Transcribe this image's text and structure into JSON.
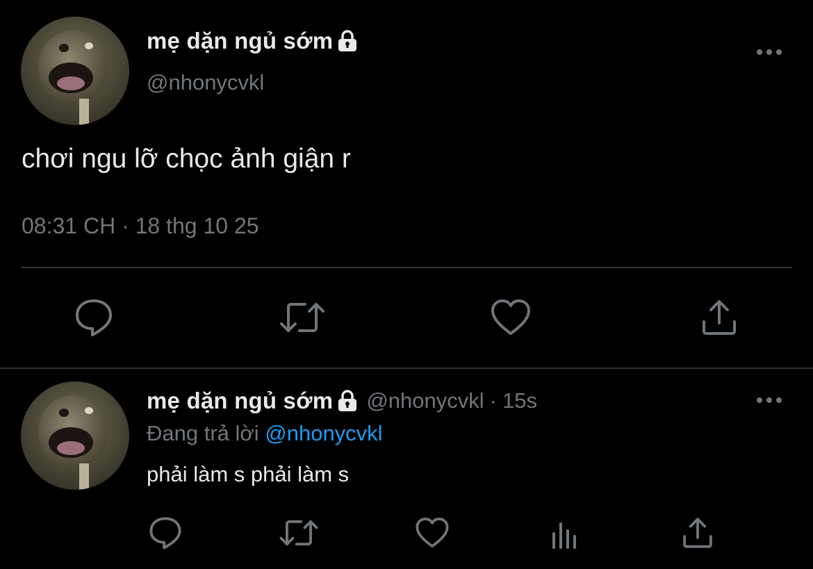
{
  "main_tweet": {
    "display_name": "mẹ dặn ngủ sớm",
    "handle": "@nhonycvkl",
    "text": "chơi ngu lỡ chọc ảnh giận r",
    "timestamp": "08:31 CH · 18 thg 10 25",
    "icons": {
      "lock": "lock-icon",
      "more": "more-options-icon",
      "actions": [
        "reply-icon",
        "retweet-icon",
        "like-icon",
        "share-icon"
      ]
    }
  },
  "reply_tweet": {
    "display_name": "mẹ dặn ngủ sớm",
    "handle": "@nhonycvkl",
    "separator": "·",
    "time": "15s",
    "replying_prefix": "Đang trả lời",
    "replying_to": "@nhonycvkl",
    "text": "phải làm s phải làm s",
    "icons": {
      "lock": "lock-icon",
      "more": "more-options-icon",
      "actions": [
        "reply-icon",
        "retweet-icon",
        "like-icon",
        "analytics-icon",
        "share-icon"
      ]
    }
  },
  "colors": {
    "background": "#000000",
    "primary_text": "#e7e9ea",
    "secondary_text": "#71767b",
    "link": "#1d9bf0",
    "divider": "#2f3336"
  }
}
